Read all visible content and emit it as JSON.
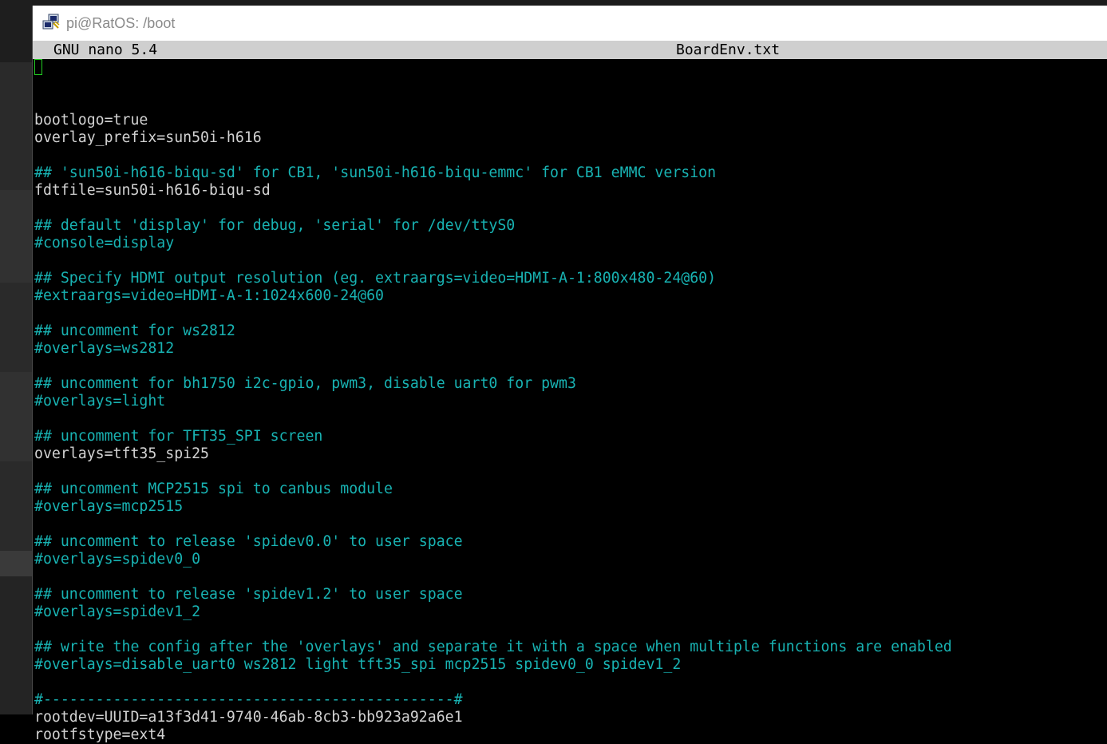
{
  "window": {
    "title": "pi@RatOS: /boot",
    "icon": "putty-icon"
  },
  "nano": {
    "version": "GNU nano 5.4",
    "filename": "BoardEnv.txt"
  },
  "colors": {
    "comment": "#18b2b2",
    "plain": "#d2d2d2",
    "header_bg": "#cfcfcf",
    "cursor": "#22cc22"
  },
  "editor": {
    "lines": [
      {
        "text": "bootlogo=true",
        "type": "plain"
      },
      {
        "text": "overlay_prefix=sun50i-h616",
        "type": "plain"
      },
      {
        "text": "",
        "type": "plain"
      },
      {
        "text": "## 'sun50i-h616-biqu-sd' for CB1, 'sun50i-h616-biqu-emmc' for CB1 eMMC version",
        "type": "comment"
      },
      {
        "text": "fdtfile=sun50i-h616-biqu-sd",
        "type": "plain"
      },
      {
        "text": "",
        "type": "plain"
      },
      {
        "text": "## default 'display' for debug, 'serial' for /dev/ttyS0",
        "type": "comment"
      },
      {
        "text": "#console=display",
        "type": "comment"
      },
      {
        "text": "",
        "type": "plain"
      },
      {
        "text": "## Specify HDMI output resolution (eg. extraargs=video=HDMI-A-1:800x480-24@60)",
        "type": "comment"
      },
      {
        "text": "#extraargs=video=HDMI-A-1:1024x600-24@60",
        "type": "comment"
      },
      {
        "text": "",
        "type": "plain"
      },
      {
        "text": "## uncomment for ws2812",
        "type": "comment"
      },
      {
        "text": "#overlays=ws2812",
        "type": "comment"
      },
      {
        "text": "",
        "type": "plain"
      },
      {
        "text": "## uncomment for bh1750 i2c-gpio, pwm3, disable uart0 for pwm3",
        "type": "comment"
      },
      {
        "text": "#overlays=light",
        "type": "comment"
      },
      {
        "text": "",
        "type": "plain"
      },
      {
        "text": "## uncomment for TFT35_SPI screen",
        "type": "comment"
      },
      {
        "text": "overlays=tft35_spi25",
        "type": "plain"
      },
      {
        "text": "",
        "type": "plain"
      },
      {
        "text": "## uncomment MCP2515 spi to canbus module",
        "type": "comment"
      },
      {
        "text": "#overlays=mcp2515",
        "type": "comment"
      },
      {
        "text": "",
        "type": "plain"
      },
      {
        "text": "## uncomment to release 'spidev0.0' to user space",
        "type": "comment"
      },
      {
        "text": "#overlays=spidev0_0",
        "type": "comment"
      },
      {
        "text": "",
        "type": "plain"
      },
      {
        "text": "## uncomment to release 'spidev1.2' to user space",
        "type": "comment"
      },
      {
        "text": "#overlays=spidev1_2",
        "type": "comment"
      },
      {
        "text": "",
        "type": "plain"
      },
      {
        "text": "## write the config after the 'overlays' and separate it with a space when multiple functions are enabled",
        "type": "comment"
      },
      {
        "text": "#overlays=disable_uart0 ws2812 light tft35_spi mcp2515 spidev0_0 spidev1_2",
        "type": "comment"
      },
      {
        "text": "",
        "type": "plain"
      },
      {
        "text": "#-----------------------------------------------#",
        "type": "comment"
      },
      {
        "text": "rootdev=UUID=a13f3d41-9740-46ab-8cb3-bb923a92a6e1",
        "type": "plain"
      },
      {
        "text": "rootfstype=ext4",
        "type": "plain"
      }
    ]
  }
}
